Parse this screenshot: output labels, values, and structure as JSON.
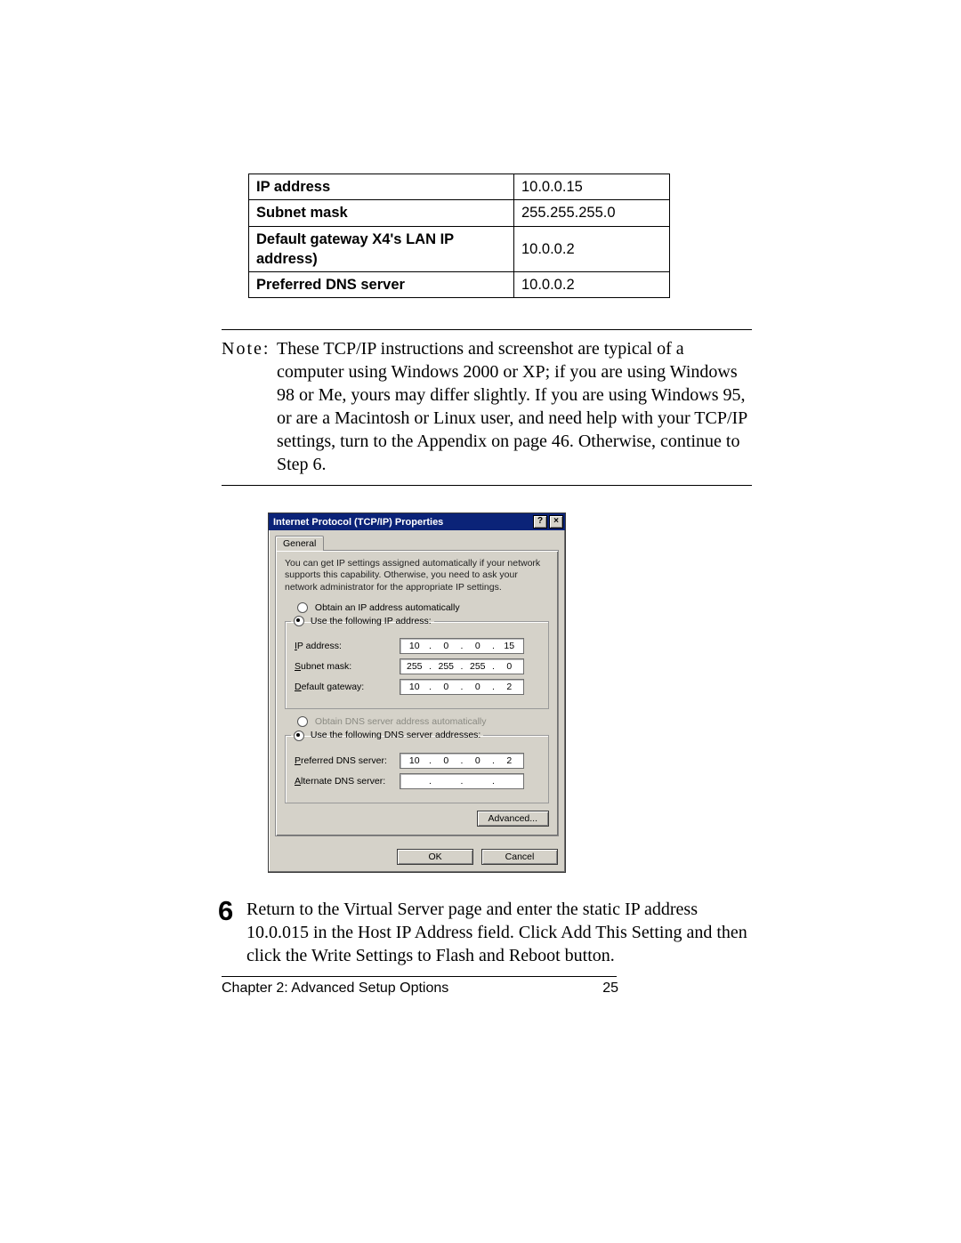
{
  "settings_table": {
    "rows": [
      {
        "label": "IP address",
        "value": "10.0.0.15"
      },
      {
        "label": "Subnet mask",
        "value": "255.255.255.0"
      },
      {
        "label": "Default gateway X4's LAN IP address)",
        "value": "10.0.0.2"
      },
      {
        "label": "Preferred DNS server",
        "value": "10.0.0.2"
      }
    ]
  },
  "note": {
    "label": "Note:",
    "text": "These TCP/IP instructions and screenshot are typical of a computer using Windows 2000 or XP; if you are using Windows 98 or Me, yours may differ slightly. If you are using Windows 95, or are a Macintosh or Linux user, and need help with your TCP/IP settings, turn to the Appendix on page 46. Otherwise, continue to Step 6."
  },
  "dialog": {
    "title": "Internet Protocol (TCP/IP) Properties",
    "help_btn": "?",
    "close_btn": "×",
    "tab": "General",
    "description": "You can get IP settings assigned automatically if your network supports this capability. Otherwise, you need to ask your network administrator for the appropriate IP settings.",
    "radio_obtain_ip": "Obtain an IP address automatically",
    "radio_use_ip": "Use the following IP address:",
    "fields_ip": {
      "ip_label_pre": "I",
      "ip_label_post": "P address:",
      "subnet_pre": "S",
      "subnet_post": "ubnet mask:",
      "gateway_pre": "D",
      "gateway_post": "efault gateway:",
      "ip": [
        "10",
        "0",
        "0",
        "15"
      ],
      "subnet": [
        "255",
        "255",
        "255",
        "0"
      ],
      "gateway": [
        "10",
        "0",
        "0",
        "2"
      ]
    },
    "radio_obtain_dns": "Obtain DNS server address automatically",
    "radio_use_dns": "Use the following DNS server addresses:",
    "fields_dns": {
      "pref_pre": "P",
      "pref_post": "referred DNS server:",
      "alt_pre": "A",
      "alt_post": "lternate DNS server:",
      "pref": [
        "10",
        "0",
        "0",
        "2"
      ],
      "alt": [
        "",
        "",
        "",
        ""
      ]
    },
    "advanced_btn": "Advanced...",
    "ok_btn": "OK",
    "cancel_btn": "Cancel"
  },
  "step6": {
    "number": "6",
    "text": "Return to the Virtual Server page and enter the static IP address 10.0.015 in the Host IP Address field. Click Add This Setting and then click the Write Settings to Flash and Reboot button."
  },
  "footer": {
    "chapter": "Chapter 2: Advanced Setup Options",
    "page": "25"
  }
}
